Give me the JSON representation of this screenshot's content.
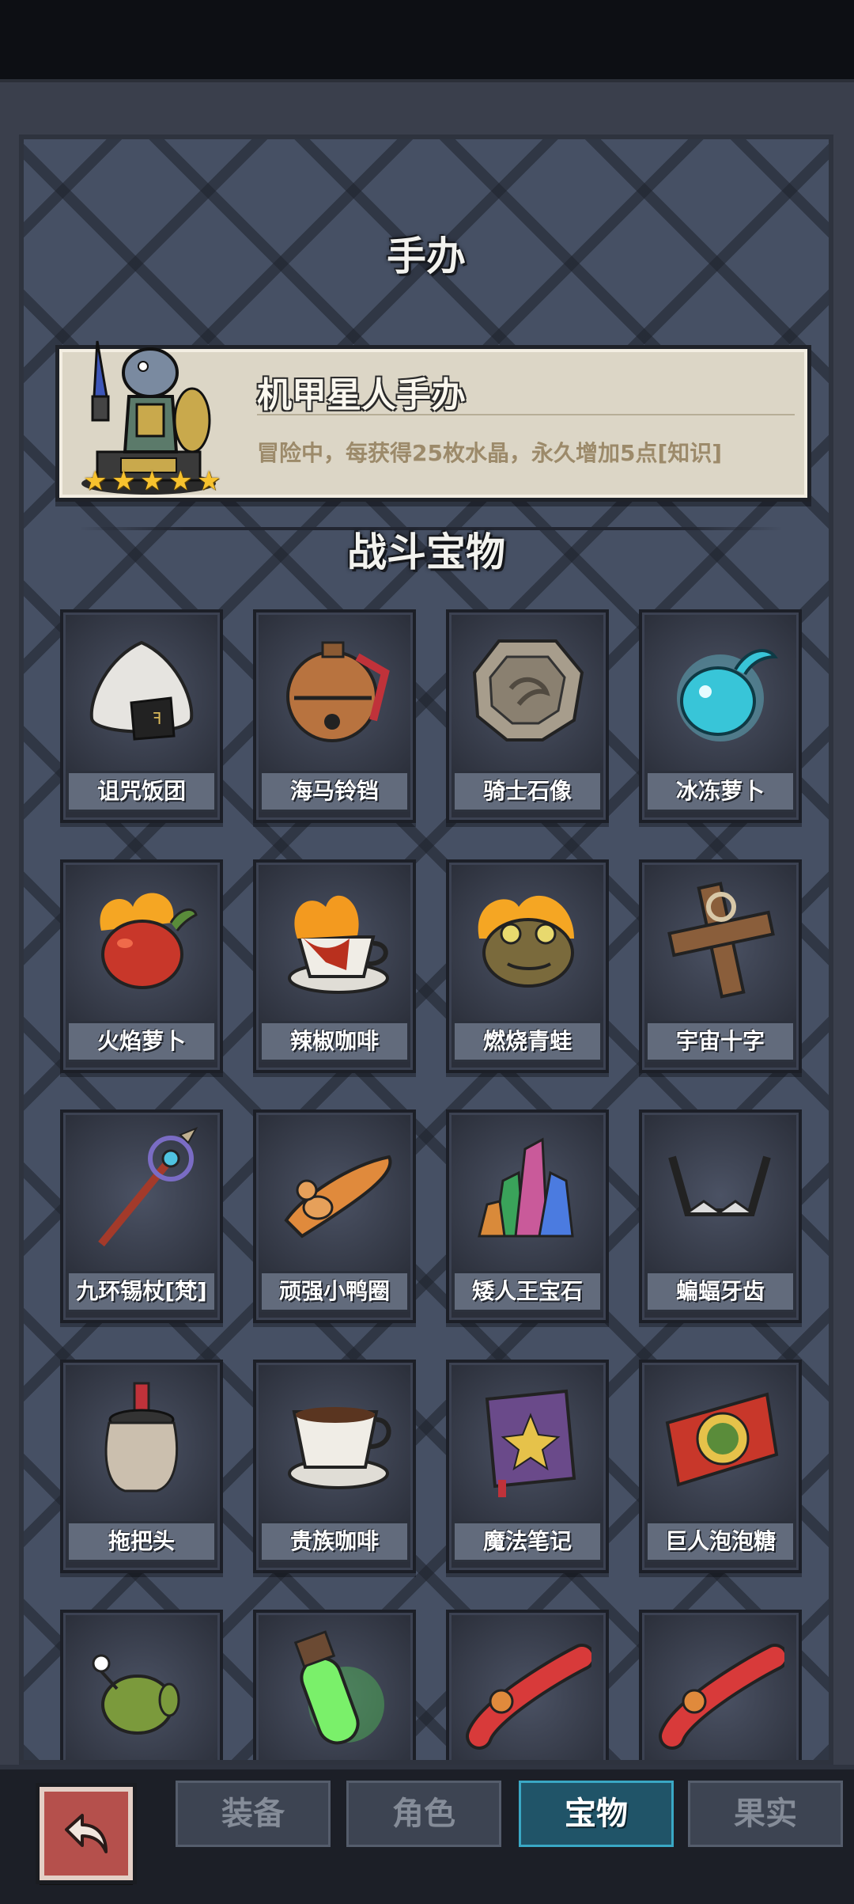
{
  "figure_section": {
    "title": "手办",
    "figure": {
      "name": "机甲星人手办",
      "description": "冒险中，每获得25枚水晶，永久增加5点[知识]",
      "stars": 5
    }
  },
  "treasure_section": {
    "title": "战斗宝物",
    "items": [
      {
        "label": "诅咒饭团",
        "icon": "rice-ball-icon"
      },
      {
        "label": "海马铃铛",
        "icon": "bell-icon"
      },
      {
        "label": "骑士石像",
        "icon": "stone-tablet-icon"
      },
      {
        "label": "冰冻萝卜",
        "icon": "ice-radish-icon"
      },
      {
        "label": "火焰萝卜",
        "icon": "fire-radish-icon"
      },
      {
        "label": "辣椒咖啡",
        "icon": "fire-coffee-icon"
      },
      {
        "label": "燃烧青蛙",
        "icon": "burning-frog-icon"
      },
      {
        "label": "宇宙十字",
        "icon": "wooden-cross-icon"
      },
      {
        "label": "九环锡杖[梵]",
        "icon": "staff-icon"
      },
      {
        "label": "顽强小鸭圈",
        "icon": "duck-ring-icon"
      },
      {
        "label": "矮人王宝石",
        "icon": "gem-cluster-icon"
      },
      {
        "label": "蝙蝠牙齿",
        "icon": "bat-teeth-icon"
      },
      {
        "label": "拖把头",
        "icon": "mop-head-icon"
      },
      {
        "label": "贵族咖啡",
        "icon": "coffee-cup-icon"
      },
      {
        "label": "魔法笔记",
        "icon": "magic-book-icon"
      },
      {
        "label": "巨人泡泡糖",
        "icon": "bubble-gum-icon"
      },
      {
        "label": "",
        "icon": "pea-plant-icon"
      },
      {
        "label": "",
        "icon": "green-potion-icon"
      },
      {
        "label": "",
        "icon": "red-sausage-icon"
      },
      {
        "label": "",
        "icon": "red-sausage-icon"
      }
    ]
  },
  "nav": {
    "back_icon": "back-arrow-icon",
    "tabs": [
      "装备",
      "角色",
      "宝物",
      "果实"
    ],
    "active_tab": "宝物"
  },
  "colors": {
    "panel": "#465064",
    "active_tab": "#205468",
    "back_button": "#b5504c",
    "star": "#f7c22e"
  }
}
